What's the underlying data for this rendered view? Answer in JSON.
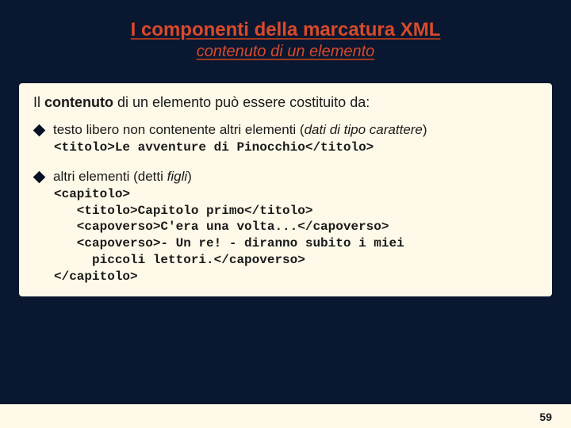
{
  "title": "I componenti della marcatura XML",
  "subtitle": "contenuto di un elemento",
  "intro": {
    "pre": "Il ",
    "bold": "contenuto",
    "post": " di un elemento può essere costituito da:"
  },
  "bullets": [
    {
      "text_pre": "testo libero non contenente altri elementi (",
      "italic": "dati di tipo carattere",
      "text_post": ")",
      "code": "<titolo>Le avventure di Pinocchio</titolo>"
    },
    {
      "text_pre": "altri elementi (detti ",
      "italic": "figli",
      "text_post": ")",
      "code": "<capitolo>\n   <titolo>Capitolo primo</titolo>\n   <capoverso>C'era una volta...</capoverso>\n   <capoverso>- Un re! - diranno subito i miei\n     piccoli lettori.</capoverso>\n</capitolo>"
    }
  ],
  "page_number": "59"
}
